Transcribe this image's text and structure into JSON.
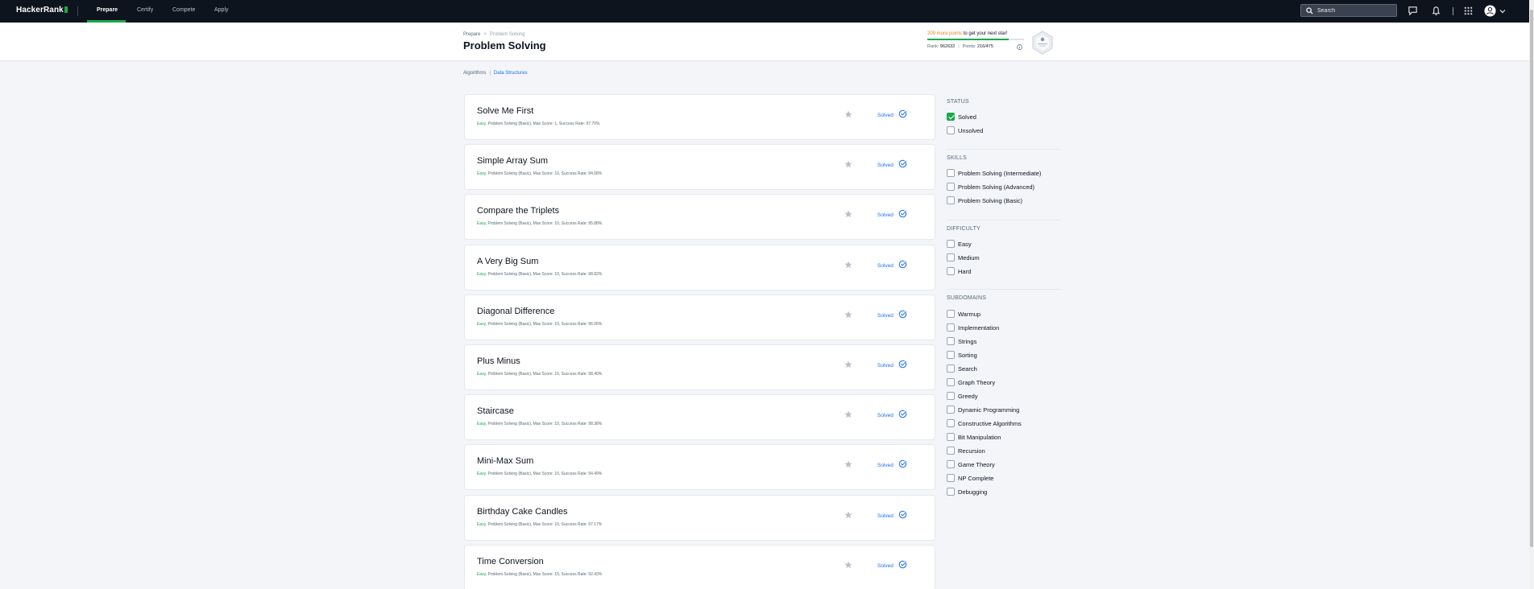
{
  "nav": {
    "logo": "HackerRank",
    "links": [
      "Prepare",
      "Certify",
      "Compete",
      "Apply"
    ],
    "search_placeholder": "Search",
    "accent": "#1ba94c",
    "icons": [
      "search-icon",
      "messages-icon",
      "notifications-icon",
      "apps-grid-icon",
      "user-avatar-icon",
      "chevron-down-icon"
    ]
  },
  "header": {
    "breadcrumb": [
      "Prepare",
      "Problem Solving"
    ],
    "title": "Problem Solving",
    "points_prefix": "209 more points",
    "points_suffix": " to get your next star!",
    "progress_fraction": 0.84,
    "rank_label": "Rank: ",
    "rank_value": "962632",
    "points_label": "Points: ",
    "points_value": "216/475",
    "badge_icon": "problem-solving-badge-icon"
  },
  "subtabs": [
    "Algorithms",
    "Data Structures"
  ],
  "challenges": [
    {
      "title": "Solve Me First",
      "difficulty": "Easy",
      "meta": ", Problem Solving (Basic), Max Score: 1, Success Rate: 97.70%",
      "status": "Solved"
    },
    {
      "title": "Simple Array Sum",
      "difficulty": "Easy",
      "meta": ", Problem Solving (Basic), Max Score: 10, Success Rate: 94.68%",
      "status": "Solved"
    },
    {
      "title": "Compare the Triplets",
      "difficulty": "Easy",
      "meta": ", Problem Solving (Basic), Max Score: 10, Success Rate: 95.88%",
      "status": "Solved"
    },
    {
      "title": "A Very Big Sum",
      "difficulty": "Easy",
      "meta": ", Problem Solving (Basic), Max Score: 10, Success Rate: 98.82%",
      "status": "Solved"
    },
    {
      "title": "Diagonal Difference",
      "difficulty": "Easy",
      "meta": ", Problem Solving (Basic), Max Score: 10, Success Rate: 96.06%",
      "status": "Solved"
    },
    {
      "title": "Plus Minus",
      "difficulty": "Easy",
      "meta": ", Problem Solving (Basic), Max Score: 10, Success Rate: 98.40%",
      "status": "Solved"
    },
    {
      "title": "Staircase",
      "difficulty": "Easy",
      "meta": ", Problem Solving (Basic), Max Score: 10, Success Rate: 98.38%",
      "status": "Solved"
    },
    {
      "title": "Mini-Max Sum",
      "difficulty": "Easy",
      "meta": ", Problem Solving (Basic), Max Score: 10, Success Rate: 94.49%",
      "status": "Solved"
    },
    {
      "title": "Birthday Cake Candles",
      "difficulty": "Easy",
      "meta": ", Problem Solving (Basic), Max Score: 10, Success Rate: 97.17%",
      "status": "Solved"
    },
    {
      "title": "Time Conversion",
      "difficulty": "Easy",
      "meta": ", Problem Solving (Basic), Max Score: 15, Success Rate: 92.43%",
      "status": "Solved"
    }
  ],
  "filters": {
    "status": {
      "heading": "STATUS",
      "options": [
        {
          "label": "Solved",
          "checked": true
        },
        {
          "label": "Unsolved",
          "checked": false
        }
      ]
    },
    "skills": {
      "heading": "SKILLS",
      "options": [
        {
          "label": "Problem Solving (Intermediate)",
          "checked": false
        },
        {
          "label": "Problem Solving (Advanced)",
          "checked": false
        },
        {
          "label": "Problem Solving (Basic)",
          "checked": false
        }
      ]
    },
    "difficulty": {
      "heading": "DIFFICULTY",
      "options": [
        {
          "label": "Easy",
          "checked": false
        },
        {
          "label": "Medium",
          "checked": false
        },
        {
          "label": "Hard",
          "checked": false
        }
      ]
    },
    "subdomains": {
      "heading": "SUBDOMAINS",
      "options": [
        {
          "label": "Warmup",
          "checked": false
        },
        {
          "label": "Implementation",
          "checked": false
        },
        {
          "label": "Strings",
          "checked": false
        },
        {
          "label": "Sorting",
          "checked": false
        },
        {
          "label": "Search",
          "checked": false
        },
        {
          "label": "Graph Theory",
          "checked": false
        },
        {
          "label": "Greedy",
          "checked": false
        },
        {
          "label": "Dynamic Programming",
          "checked": false
        },
        {
          "label": "Constructive Algorithms",
          "checked": false
        },
        {
          "label": "Bit Manipulation",
          "checked": false
        },
        {
          "label": "Recursion",
          "checked": false
        },
        {
          "label": "Game Theory",
          "checked": false
        },
        {
          "label": "NP Complete",
          "checked": false
        },
        {
          "label": "Debugging",
          "checked": false
        }
      ]
    }
  },
  "colors": {
    "brand_green": "#1ba94c",
    "link_blue": "#1d6ef3",
    "nav_bg": "#0e141e",
    "points_orange": "#ef7f1a"
  }
}
